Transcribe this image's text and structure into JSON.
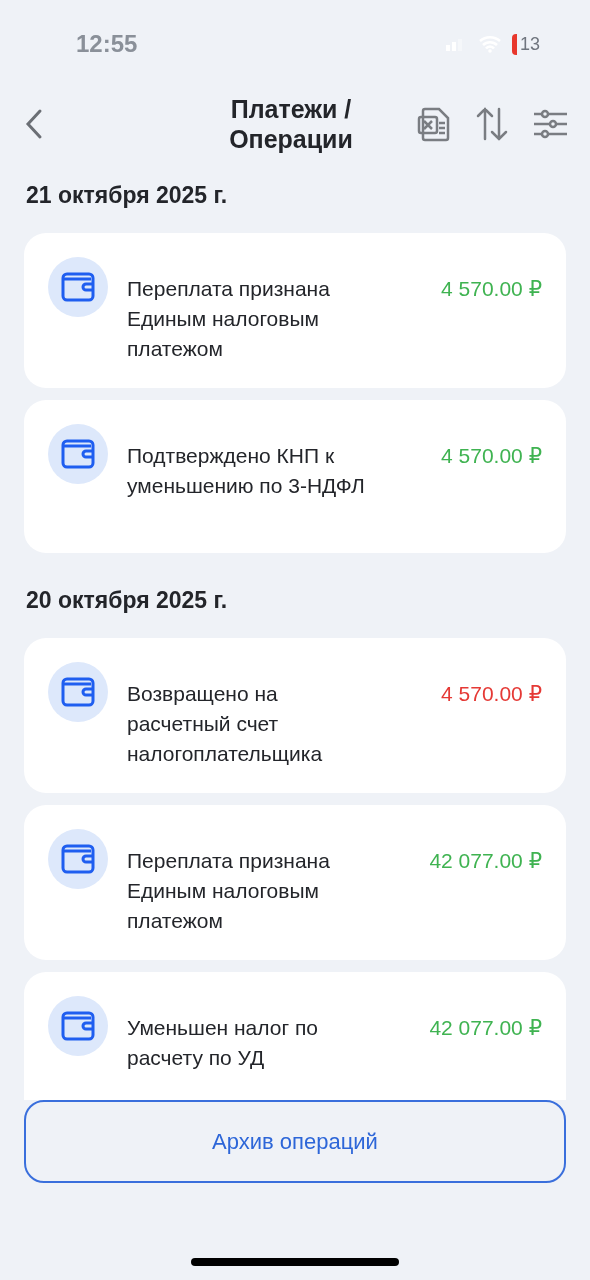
{
  "status_bar": {
    "time": "12:55",
    "battery": "13"
  },
  "header": {
    "title": "Платежи / Операции"
  },
  "groups": [
    {
      "date": "21 октября 2025 г.",
      "operations": [
        {
          "title": "Переплата признана Единым налоговым платежом",
          "amount": "4 570.00 ₽",
          "kind": "credit"
        },
        {
          "title": "Подтверждено КНП к уменьшению по 3-НДФЛ",
          "amount": "4 570.00 ₽",
          "kind": "credit"
        }
      ]
    },
    {
      "date": "20 октября 2025 г.",
      "operations": [
        {
          "title": "Возвращено на расчетный счет налогоплательщика",
          "amount": "4 570.00 ₽",
          "kind": "debit"
        },
        {
          "title": "Переплата признана Единым налоговым платежом",
          "amount": "42 077.00 ₽",
          "kind": "credit"
        },
        {
          "title": "Уменьшен налог по расчету по УД",
          "amount": "42 077.00 ₽",
          "kind": "credit"
        }
      ]
    }
  ],
  "archive_button": "Архив операций"
}
